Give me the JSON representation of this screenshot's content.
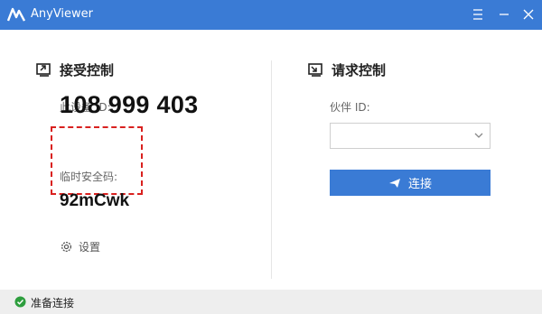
{
  "window": {
    "title": "AnyViewer",
    "icons": [
      "anyviewer-logo-icon",
      "menu-icon",
      "minimize-icon",
      "close-icon"
    ]
  },
  "receive": {
    "heading": "接受控制",
    "device_id_label": "此设备 ID:",
    "device_id": "108 999 403",
    "temp_code_label": "临时安全码:",
    "temp_code": "92mCwk",
    "settings_label": "设置"
  },
  "request": {
    "heading": "请求控制",
    "partner_id_label": "伙伴 ID:",
    "partner_id_value": "",
    "connect_label": "连接"
  },
  "status": {
    "text": "准备连接"
  },
  "colors": {
    "accent": "#3a7bd5",
    "highlight_border": "#d9211f",
    "status_ok": "#2e9e3e"
  }
}
